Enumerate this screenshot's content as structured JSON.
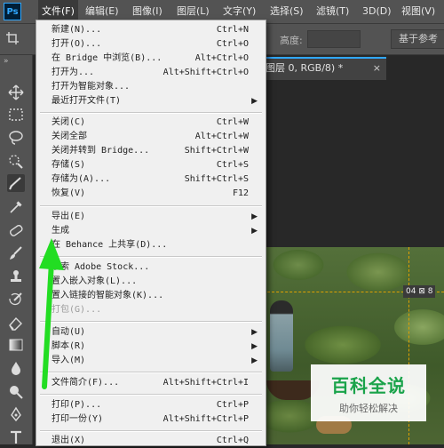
{
  "app": {
    "logo": "Ps",
    "accent_color": "#31a8ff"
  },
  "menubar": {
    "items": [
      {
        "label": "文件(F)",
        "active": true
      },
      {
        "label": "编辑(E)"
      },
      {
        "label": "图像(I)"
      },
      {
        "label": "图层(L)"
      },
      {
        "label": "文字(Y)"
      },
      {
        "label": "选择(S)"
      },
      {
        "label": "滤镜(T)"
      },
      {
        "label": "3D(D)"
      },
      {
        "label": "视图(V)"
      }
    ]
  },
  "options_bar": {
    "height_label": "高度:",
    "button_label": "基于参考"
  },
  "tools_panel": {
    "collapse_glyph": "»",
    "tools": [
      {
        "icon": "move-icon"
      },
      {
        "icon": "marquee-icon"
      },
      {
        "icon": "lasso-icon"
      },
      {
        "icon": "quick-select-icon"
      },
      {
        "icon": "crop-icon",
        "selected": true
      },
      {
        "icon": "eyedropper-icon"
      },
      {
        "icon": "healing-brush-icon"
      },
      {
        "icon": "brush-icon"
      },
      {
        "icon": "clone-stamp-icon"
      },
      {
        "icon": "history-brush-icon"
      },
      {
        "icon": "eraser-icon"
      },
      {
        "icon": "gradient-icon"
      },
      {
        "icon": "blur-icon"
      },
      {
        "icon": "dodge-icon"
      },
      {
        "icon": "pen-icon"
      },
      {
        "icon": "type-icon"
      }
    ]
  },
  "document": {
    "tab_title": "图层 0, RGB/8) *",
    "tab_close": "×",
    "layer_badge": "04 ⊠ 8",
    "guide_color": "#e0a000"
  },
  "watermark": {
    "title": "百科全说",
    "subtitle": "助你轻松解决",
    "title_color": "#1aa34a"
  },
  "file_menu": {
    "items": [
      {
        "label": "新建(N)...",
        "shortcut": "Ctrl+N"
      },
      {
        "label": "打开(O)...",
        "shortcut": "Ctrl+O"
      },
      {
        "label": "在 Bridge 中浏览(B)...",
        "shortcut": "Alt+Ctrl+O"
      },
      {
        "label": "打开为...",
        "shortcut": "Alt+Shift+Ctrl+O"
      },
      {
        "label": "打开为智能对象..."
      },
      {
        "label": "最近打开文件(T)",
        "submenu": true
      },
      {
        "separator": true
      },
      {
        "label": "关闭(C)",
        "shortcut": "Ctrl+W"
      },
      {
        "label": "关闭全部",
        "shortcut": "Alt+Ctrl+W"
      },
      {
        "label": "关闭并转到 Bridge...",
        "shortcut": "Shift+Ctrl+W"
      },
      {
        "label": "存储(S)",
        "shortcut": "Ctrl+S"
      },
      {
        "label": "存储为(A)...",
        "shortcut": "Shift+Ctrl+S"
      },
      {
        "label": "恢复(V)",
        "shortcut": "F12"
      },
      {
        "separator": true
      },
      {
        "label": "导出(E)",
        "submenu": true
      },
      {
        "label": "生成",
        "submenu": true
      },
      {
        "label": "在 Behance 上共享(D)..."
      },
      {
        "separator": true
      },
      {
        "label": "搜索 Adobe Stock..."
      },
      {
        "label": "置入嵌入对象(L)..."
      },
      {
        "label": "置入链接的智能对象(K)..."
      },
      {
        "label": "打包(G)...",
        "disabled": true
      },
      {
        "separator": true
      },
      {
        "label": "自动(U)",
        "submenu": true
      },
      {
        "label": "脚本(R)",
        "submenu": true
      },
      {
        "label": "导入(M)",
        "submenu": true
      },
      {
        "separator": true
      },
      {
        "label": "文件简介(F)...",
        "shortcut": "Alt+Shift+Ctrl+I"
      },
      {
        "separator": true
      },
      {
        "label": "打印(P)...",
        "shortcut": "Ctrl+P"
      },
      {
        "label": "打印一份(Y)",
        "shortcut": "Alt+Shift+Ctrl+P"
      },
      {
        "separator": true
      },
      {
        "label": "退出(X)",
        "shortcut": "Ctrl+Q"
      }
    ]
  },
  "annotation": {
    "arrow_color": "#22dd22"
  }
}
